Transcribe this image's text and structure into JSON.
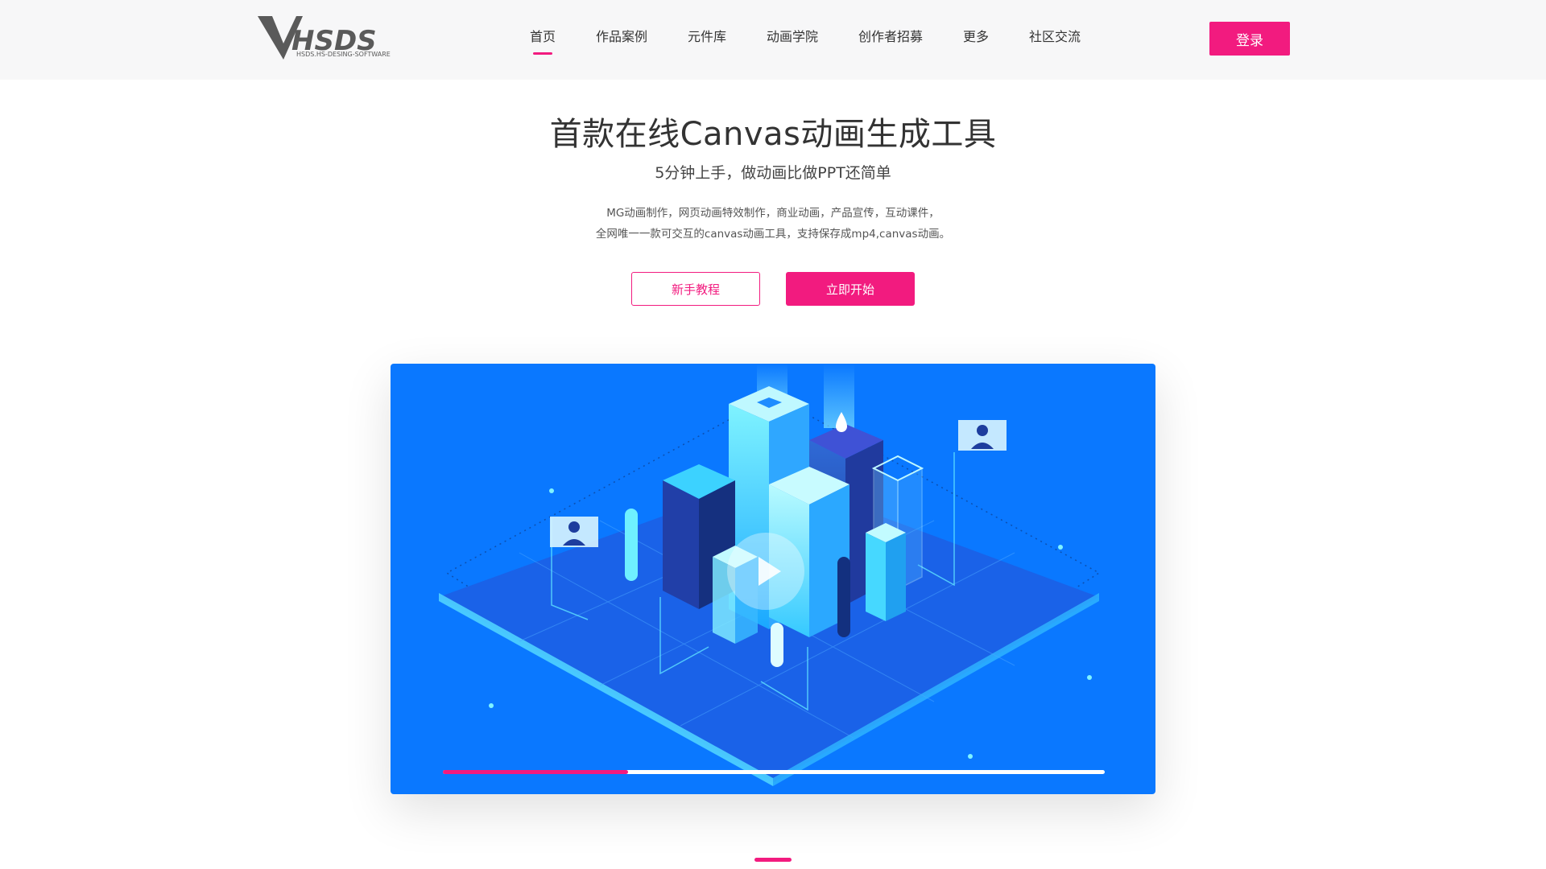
{
  "brand": {
    "logo_text": "HSDS",
    "logo_tagline": "HSDS.HS-DESING-SOFTWARE",
    "accent_color": "#f21b7f",
    "video_bg_color": "#0a78ff"
  },
  "nav": {
    "items": [
      {
        "label": "首页",
        "active": true
      },
      {
        "label": "作品案例",
        "active": false
      },
      {
        "label": "元件库",
        "active": false
      },
      {
        "label": "动画学院",
        "active": false
      },
      {
        "label": "创作者招募",
        "active": false
      },
      {
        "label": "更多",
        "active": false
      },
      {
        "label": "社区交流",
        "active": false
      }
    ],
    "login_label": "登录"
  },
  "hero": {
    "title": "首款在线Canvas动画生成工具",
    "subtitle": "5分钟上手，做动画比做PPT还简单",
    "desc_line1": "MG动画制作，网页动画特效制作，商业动画，产品宣传，互动课件，",
    "desc_line2": "全网唯一一款可交互的canvas动画工具，支持保存成mp4,canvas动画。",
    "tutorial_label": "新手教程",
    "start_label": "立即开始"
  },
  "video": {
    "play_icon": "play-icon",
    "progress_fraction": 0.28
  }
}
